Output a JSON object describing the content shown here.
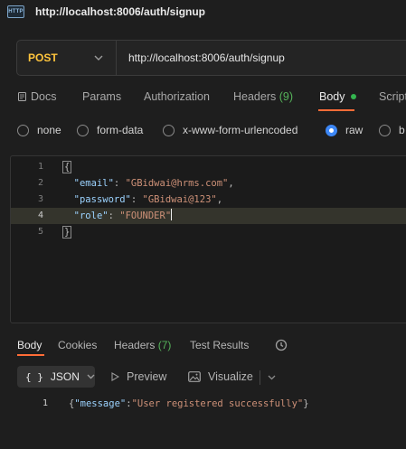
{
  "titlebar": {
    "badge": "HTTP",
    "title": "http://localhost:8006/auth/signup"
  },
  "request": {
    "method": "POST",
    "method_color": "#ffc53d",
    "url": "http://localhost:8006/auth/signup"
  },
  "tabs": {
    "docs": "Docs",
    "params": "Params",
    "authorization": "Authorization",
    "headers": "Headers",
    "headers_count": "(9)",
    "body": "Body",
    "scripts": "Scripts"
  },
  "body_types": [
    "none",
    "form-data",
    "x-www-form-urlencoded",
    "raw",
    "b"
  ],
  "selected_body_type": "raw",
  "editor": {
    "line_numbers": [
      "1",
      "2",
      "3",
      "4",
      "5"
    ],
    "open_brace": "{",
    "close_brace": "}",
    "fields": [
      {
        "key": "\"email\"",
        "value": "\"GBidwai@hrms.com\"",
        "trail": ","
      },
      {
        "key": "\"password\"",
        "value": "\"GBidwai@123\"",
        "trail": ","
      },
      {
        "key": "\"role\"",
        "value": "\"FOUNDER\"",
        "trail": ""
      }
    ]
  },
  "response": {
    "tabs": {
      "body": "Body",
      "cookies": "Cookies",
      "headers": "Headers",
      "headers_count": "(7)",
      "test_results": "Test Results"
    },
    "format": "JSON",
    "format_icon": "{ }",
    "preview": "Preview",
    "visualize": "Visualize",
    "line_number": "1",
    "json_key": "\"message\"",
    "json_value": "\"User registered successfully\""
  },
  "colors": {
    "accent": "#ff6c37",
    "success": "#34b54f",
    "radio_selected": "#3d87f5"
  }
}
